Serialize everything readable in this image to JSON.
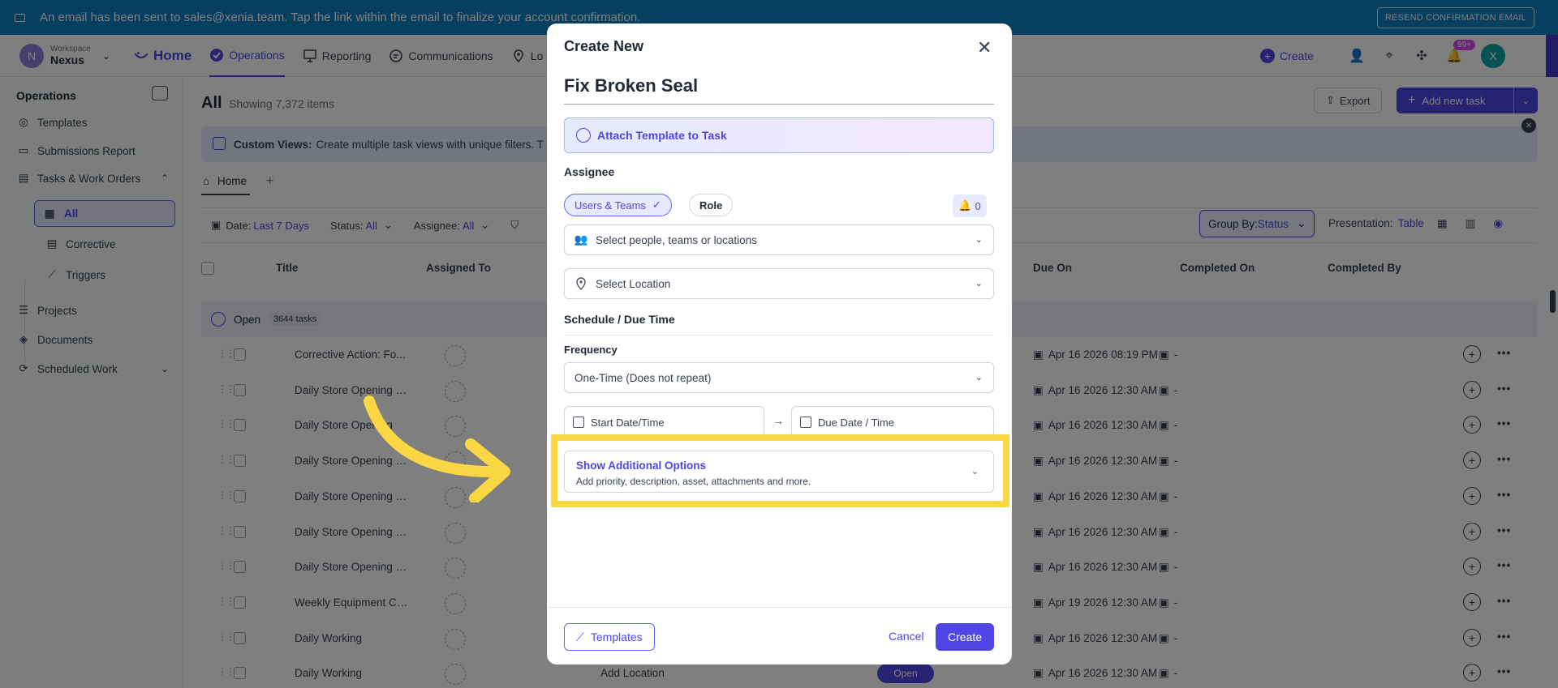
{
  "banner": {
    "message": "An email has been sent to sales@xenia.team. Tap the link within the email to finalize your account confirmation.",
    "resend_label": "RESEND CONFIRMATION EMAIL"
  },
  "nav": {
    "workspace_label": "Workspace",
    "workspace_name": "Nexus",
    "workspace_initial": "N",
    "home_label": "Home",
    "items": [
      "Operations",
      "Reporting",
      "Communications",
      "Lo"
    ],
    "create_label": "Create",
    "notif_badge": "99+",
    "user_initial": "X"
  },
  "sidebar": {
    "section_label": "Operations",
    "items": [
      "Templates",
      "Submissions Report",
      "Tasks & Work Orders",
      "All",
      "Corrective",
      "Triggers",
      "Projects",
      "Documents",
      "Scheduled Work"
    ]
  },
  "main": {
    "title": "All",
    "count": "Showing 7,372 items",
    "export_label": "Export",
    "add_new_label": "Add new task",
    "info_bold": "Custom Views:",
    "info_text": "Create multiple task views with unique filters. T",
    "tab_home": "Home",
    "tab_add": "+",
    "filters": {
      "date_label": "Date:",
      "date_value": "Last 7 Days",
      "status_label": "Status:",
      "status_value": "All",
      "assignee_label": "Assignee:",
      "assignee_value": "All"
    },
    "group_by_label": "Group By:",
    "group_by_value": "Status",
    "presentation_label": "Presentation:",
    "presentation_value": "Table",
    "columns": [
      "Title",
      "Assigned To",
      "Due On",
      "Completed On",
      "Completed By"
    ],
    "group_name": "Open",
    "group_count": "3644 tasks",
    "rows": [
      {
        "title": "Corrective Action: Fo...",
        "due": "Apr 16 2026 08:19 PM",
        "completed": "-"
      },
      {
        "title": "Daily Store Opening C...",
        "due": "Apr 16 2026 12:30 AM",
        "completed": "-"
      },
      {
        "title": "Daily Store Opening",
        "due": "Apr 16 2026 12:30 AM",
        "completed": "-"
      },
      {
        "title": "Daily Store Opening C...",
        "due": "Apr 16 2026 12:30 AM",
        "completed": "-"
      },
      {
        "title": "Daily Store Opening C...",
        "due": "Apr 16 2026 12:30 AM",
        "completed": "-"
      },
      {
        "title": "Daily Store Opening C...",
        "due": "Apr 16 2026 12:30 AM",
        "completed": "-"
      },
      {
        "title": "Daily Store Opening C...",
        "due": "Apr 16 2026 12:30 AM",
        "completed": "-"
      },
      {
        "title": "Weekly Equipment Ch...",
        "due": "Apr 19 2026 12:30 AM",
        "completed": "-"
      },
      {
        "title": "Daily Working",
        "due": "Apr 16 2026 12:30 AM",
        "completed": "-"
      },
      {
        "title": "Daily Working",
        "due": "Apr 16 2026 12:30 AM",
        "completed": "-"
      }
    ],
    "last_row_location": "Add Location",
    "last_row_status": "Open"
  },
  "modal": {
    "title": "Create New",
    "task_name": "Fix Broken Seal",
    "attach_label": "Attach Template to Task",
    "assignee_label": "Assignee",
    "chip_users": "Users & Teams",
    "chip_role": "Role",
    "bell_count": "0",
    "people_placeholder": "Select people, teams or locations",
    "location_placeholder": "Select Location",
    "schedule_label": "Schedule / Due Time",
    "frequency_label": "Frequency",
    "frequency_value": "One-Time (Does not repeat)",
    "start_label": "Start Date/Time",
    "due_label": "Due Date / Time",
    "additional_title": "Show Additional Options",
    "additional_subtitle": "Add priority, description, asset, attachments and more.",
    "templates_label": "Templates",
    "cancel_label": "Cancel",
    "create_label": "Create"
  },
  "colors": {
    "accent": "#4f46e5",
    "banner": "#0e7fc1",
    "highlight": "#fbd743"
  }
}
